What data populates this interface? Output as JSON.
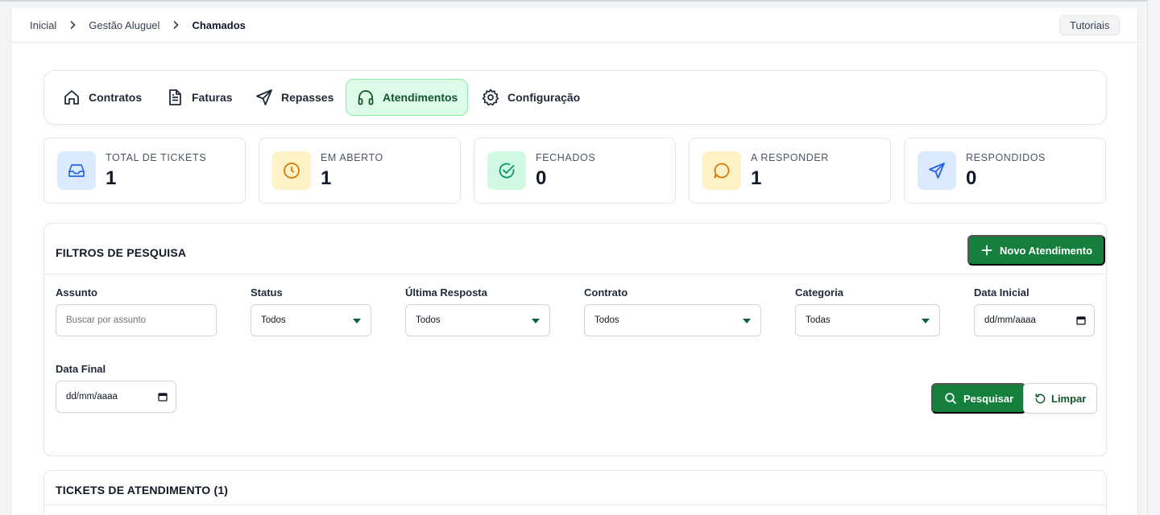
{
  "breadcrumb": [
    "Inicial",
    "Gestão Aluguel",
    "Chamados"
  ],
  "header": {
    "tutorials_label": "Tutoriais"
  },
  "tabs": [
    {
      "label": "Contratos",
      "icon": "home-icon"
    },
    {
      "label": "Faturas",
      "icon": "document-icon"
    },
    {
      "label": "Repasses",
      "icon": "send-icon"
    },
    {
      "label": "Atendimentos",
      "icon": "headphones-icon",
      "active": true
    },
    {
      "label": "Configuração",
      "icon": "gear-icon"
    }
  ],
  "stats": [
    {
      "label": "TOTAL DE TICKETS",
      "value": "1",
      "icon": "inbox-icon",
      "color": "#2563eb",
      "bg": "#dbeafe"
    },
    {
      "label": "EM ABERTO",
      "value": "1",
      "icon": "clock-icon",
      "color": "#d97706",
      "bg": "#fef3c7"
    },
    {
      "label": "FECHADOS",
      "value": "0",
      "icon": "check-circle-icon",
      "color": "#059669",
      "bg": "#d1fae5"
    },
    {
      "label": "A RESPONDER",
      "value": "1",
      "icon": "chat-bubble-icon",
      "color": "#d97706",
      "bg": "#fef3c7"
    },
    {
      "label": "RESPONDIDOS",
      "value": "0",
      "icon": "send-icon",
      "color": "#2563eb",
      "bg": "#dbeafe"
    }
  ],
  "filters": {
    "title": "FILTROS DE PESQUISA",
    "new_button": "Novo Atendimento",
    "subject": {
      "label": "Assunto",
      "placeholder": "Buscar por assunto"
    },
    "status": {
      "label": "Status",
      "value": "Todos"
    },
    "last_reply": {
      "label": "Última Resposta",
      "value": "Todos"
    },
    "contract": {
      "label": "Contrato",
      "value": "Todos"
    },
    "category": {
      "label": "Categoria",
      "value": "Todas"
    },
    "start_date": {
      "label": "Data Inicial",
      "value": "dd/mm/aaaa"
    },
    "end_date": {
      "label": "Data Final",
      "value": "dd/mm/aaaa"
    },
    "search_button": "Pesquisar",
    "clear_button": "Limpar"
  },
  "tickets": {
    "title": "TICKETS DE ATENDIMENTO (1)"
  },
  "colors": {
    "primary_green": "#15803d",
    "active_tab_bg": "#dcfce7"
  }
}
